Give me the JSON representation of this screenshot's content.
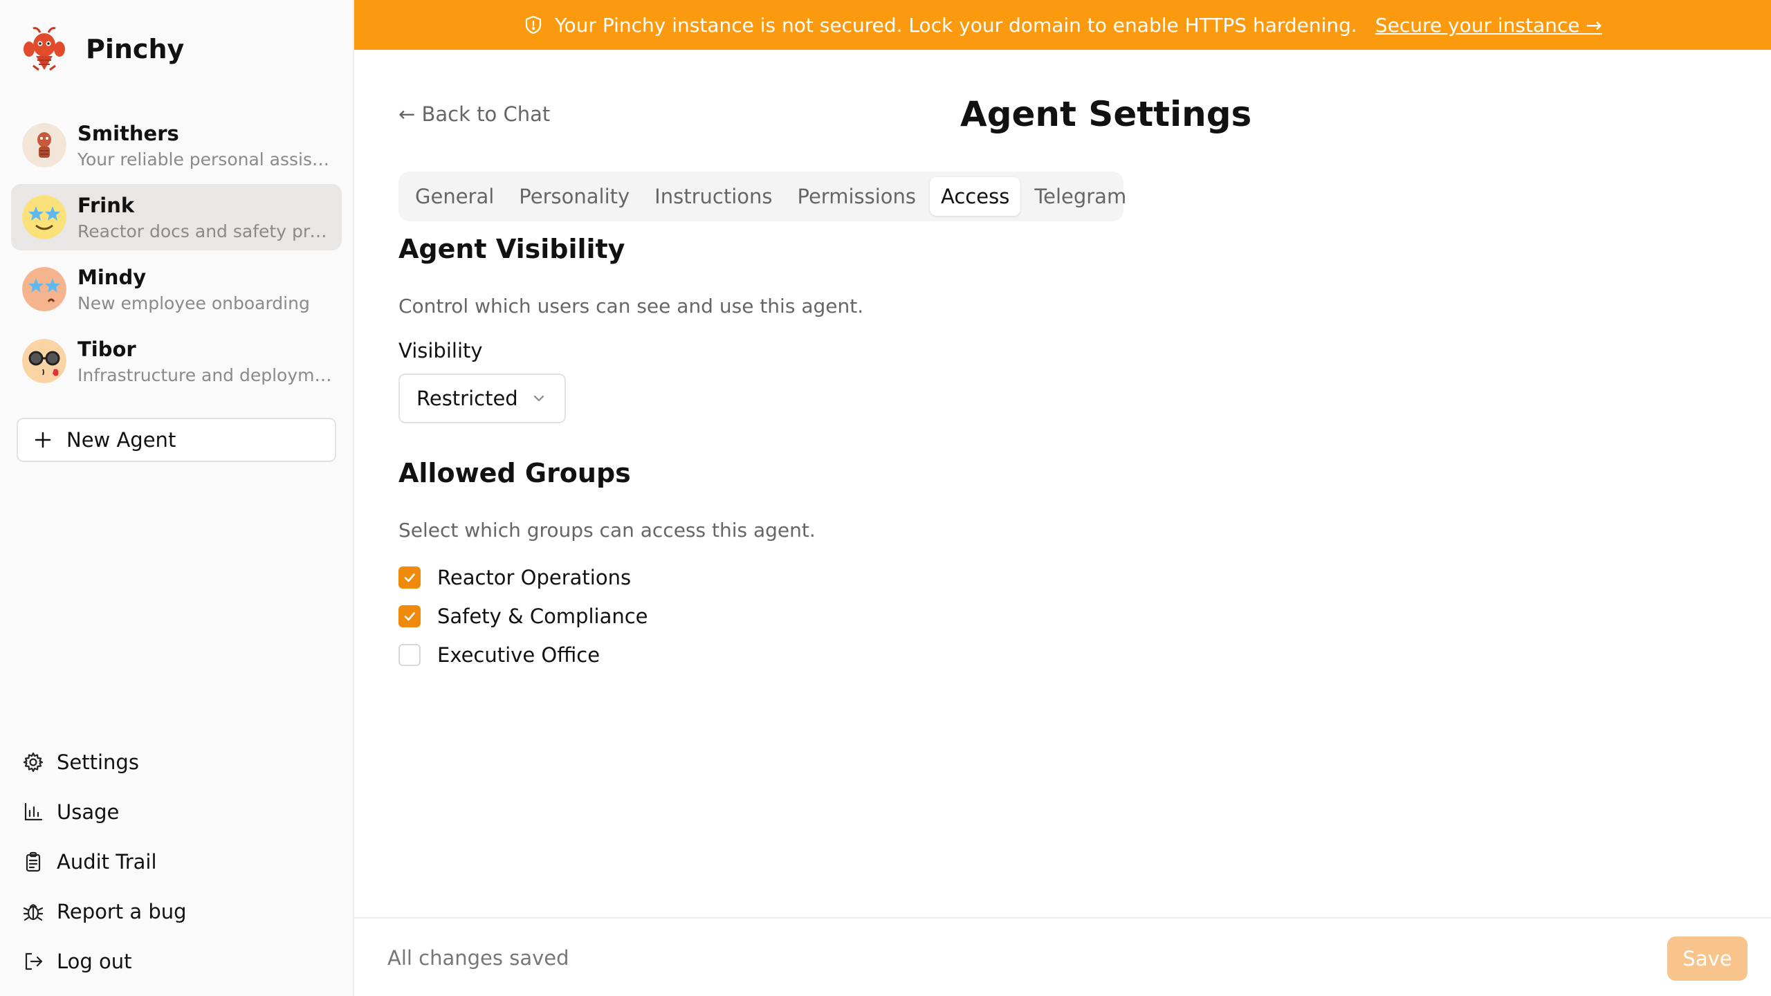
{
  "app": {
    "name": "Pinchy"
  },
  "banner": {
    "message": "Your Pinchy instance is not secured. Lock your domain to enable HTTPS hardening.",
    "link": "Secure your instance →",
    "color": "#fb9a0e"
  },
  "agents": [
    {
      "name": "Smithers",
      "description": "Your reliable personal assist…"
    },
    {
      "name": "Frink",
      "description": "Reactor docs and safety pro…"
    },
    {
      "name": "Mindy",
      "description": "New employee onboarding"
    },
    {
      "name": "Tibor",
      "description": "Infrastructure and deploym…"
    }
  ],
  "sidebar": {
    "new_agent": "New Agent",
    "nav": [
      {
        "label": "Settings",
        "icon": "gear-icon"
      },
      {
        "label": "Usage",
        "icon": "bar-chart-icon"
      },
      {
        "label": "Audit Trail",
        "icon": "clipboard-icon"
      },
      {
        "label": "Report a bug",
        "icon": "bug-icon"
      },
      {
        "label": "Log out",
        "icon": "logout-icon"
      }
    ]
  },
  "header": {
    "back": "← Back to Chat",
    "title": "Agent Settings"
  },
  "tabs": [
    {
      "label": "General"
    },
    {
      "label": "Personality"
    },
    {
      "label": "Instructions"
    },
    {
      "label": "Permissions"
    },
    {
      "label": "Access",
      "active": true
    },
    {
      "label": "Telegram"
    }
  ],
  "visibility": {
    "title": "Agent Visibility",
    "description": "Control which users can see and use this agent.",
    "label": "Visibility",
    "value": "Restricted"
  },
  "groups": {
    "title": "Allowed Groups",
    "description": "Select which groups can access this agent.",
    "items": [
      {
        "label": "Reactor Operations",
        "checked": true
      },
      {
        "label": "Safety & Compliance",
        "checked": true
      },
      {
        "label": "Executive Office",
        "checked": false
      }
    ]
  },
  "footer": {
    "status": "All changes saved",
    "save": "Save"
  },
  "colors": {
    "accent": "#f08a0c",
    "save_disabled": "#f8c48c"
  }
}
